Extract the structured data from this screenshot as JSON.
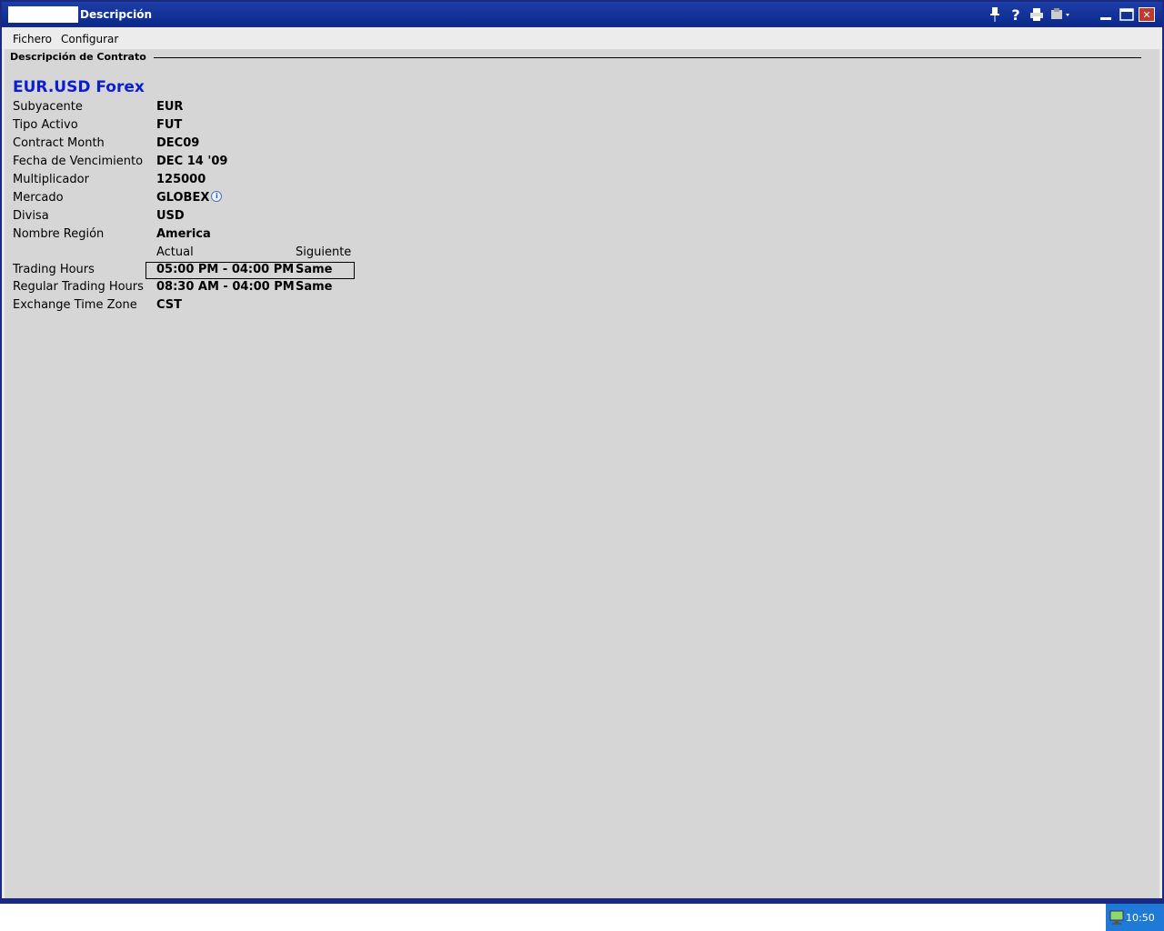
{
  "window": {
    "title": "Descripción"
  },
  "menu": {
    "file": "Fichero",
    "config": "Configurar"
  },
  "section": {
    "title": "Descripción de Contrato"
  },
  "contract": {
    "title": "EUR.USD Forex",
    "fields": {
      "underlying_label": "Subyacente",
      "underlying_value": "EUR",
      "asset_type_label": "Tipo Activo",
      "asset_type_value": "FUT",
      "contract_month_label": "Contract Month",
      "contract_month_value": "DEC09",
      "expiry_label": "Fecha de Vencimiento",
      "expiry_value": "DEC 14 '09",
      "multiplier_label": "Multiplicador",
      "multiplier_value": "125000",
      "market_label": "Mercado",
      "market_value": "GLOBEX",
      "currency_label": "Divisa",
      "currency_value": "USD",
      "region_label": "Nombre Región",
      "region_value": "America"
    },
    "hours": {
      "col_current": "Actual",
      "col_next": "Siguiente",
      "trading_label": "Trading Hours",
      "trading_current": "05:00 PM - 04:00 PM",
      "trading_next": "Same",
      "regular_label": "Regular Trading Hours",
      "regular_current": "08:30 AM - 04:00 PM",
      "regular_next": "Same",
      "tz_label": "Exchange Time Zone",
      "tz_value": "CST"
    }
  },
  "taskbar": {
    "clock": "10:50"
  },
  "icons": {
    "pin": "pin-icon",
    "help": "help-icon",
    "print": "print-icon",
    "tools": "tools-dropdown-icon",
    "minimize": "minimize-icon",
    "maximize": "maximize-icon",
    "close": "close-icon",
    "info": "info-icon",
    "network": "network-icon"
  }
}
